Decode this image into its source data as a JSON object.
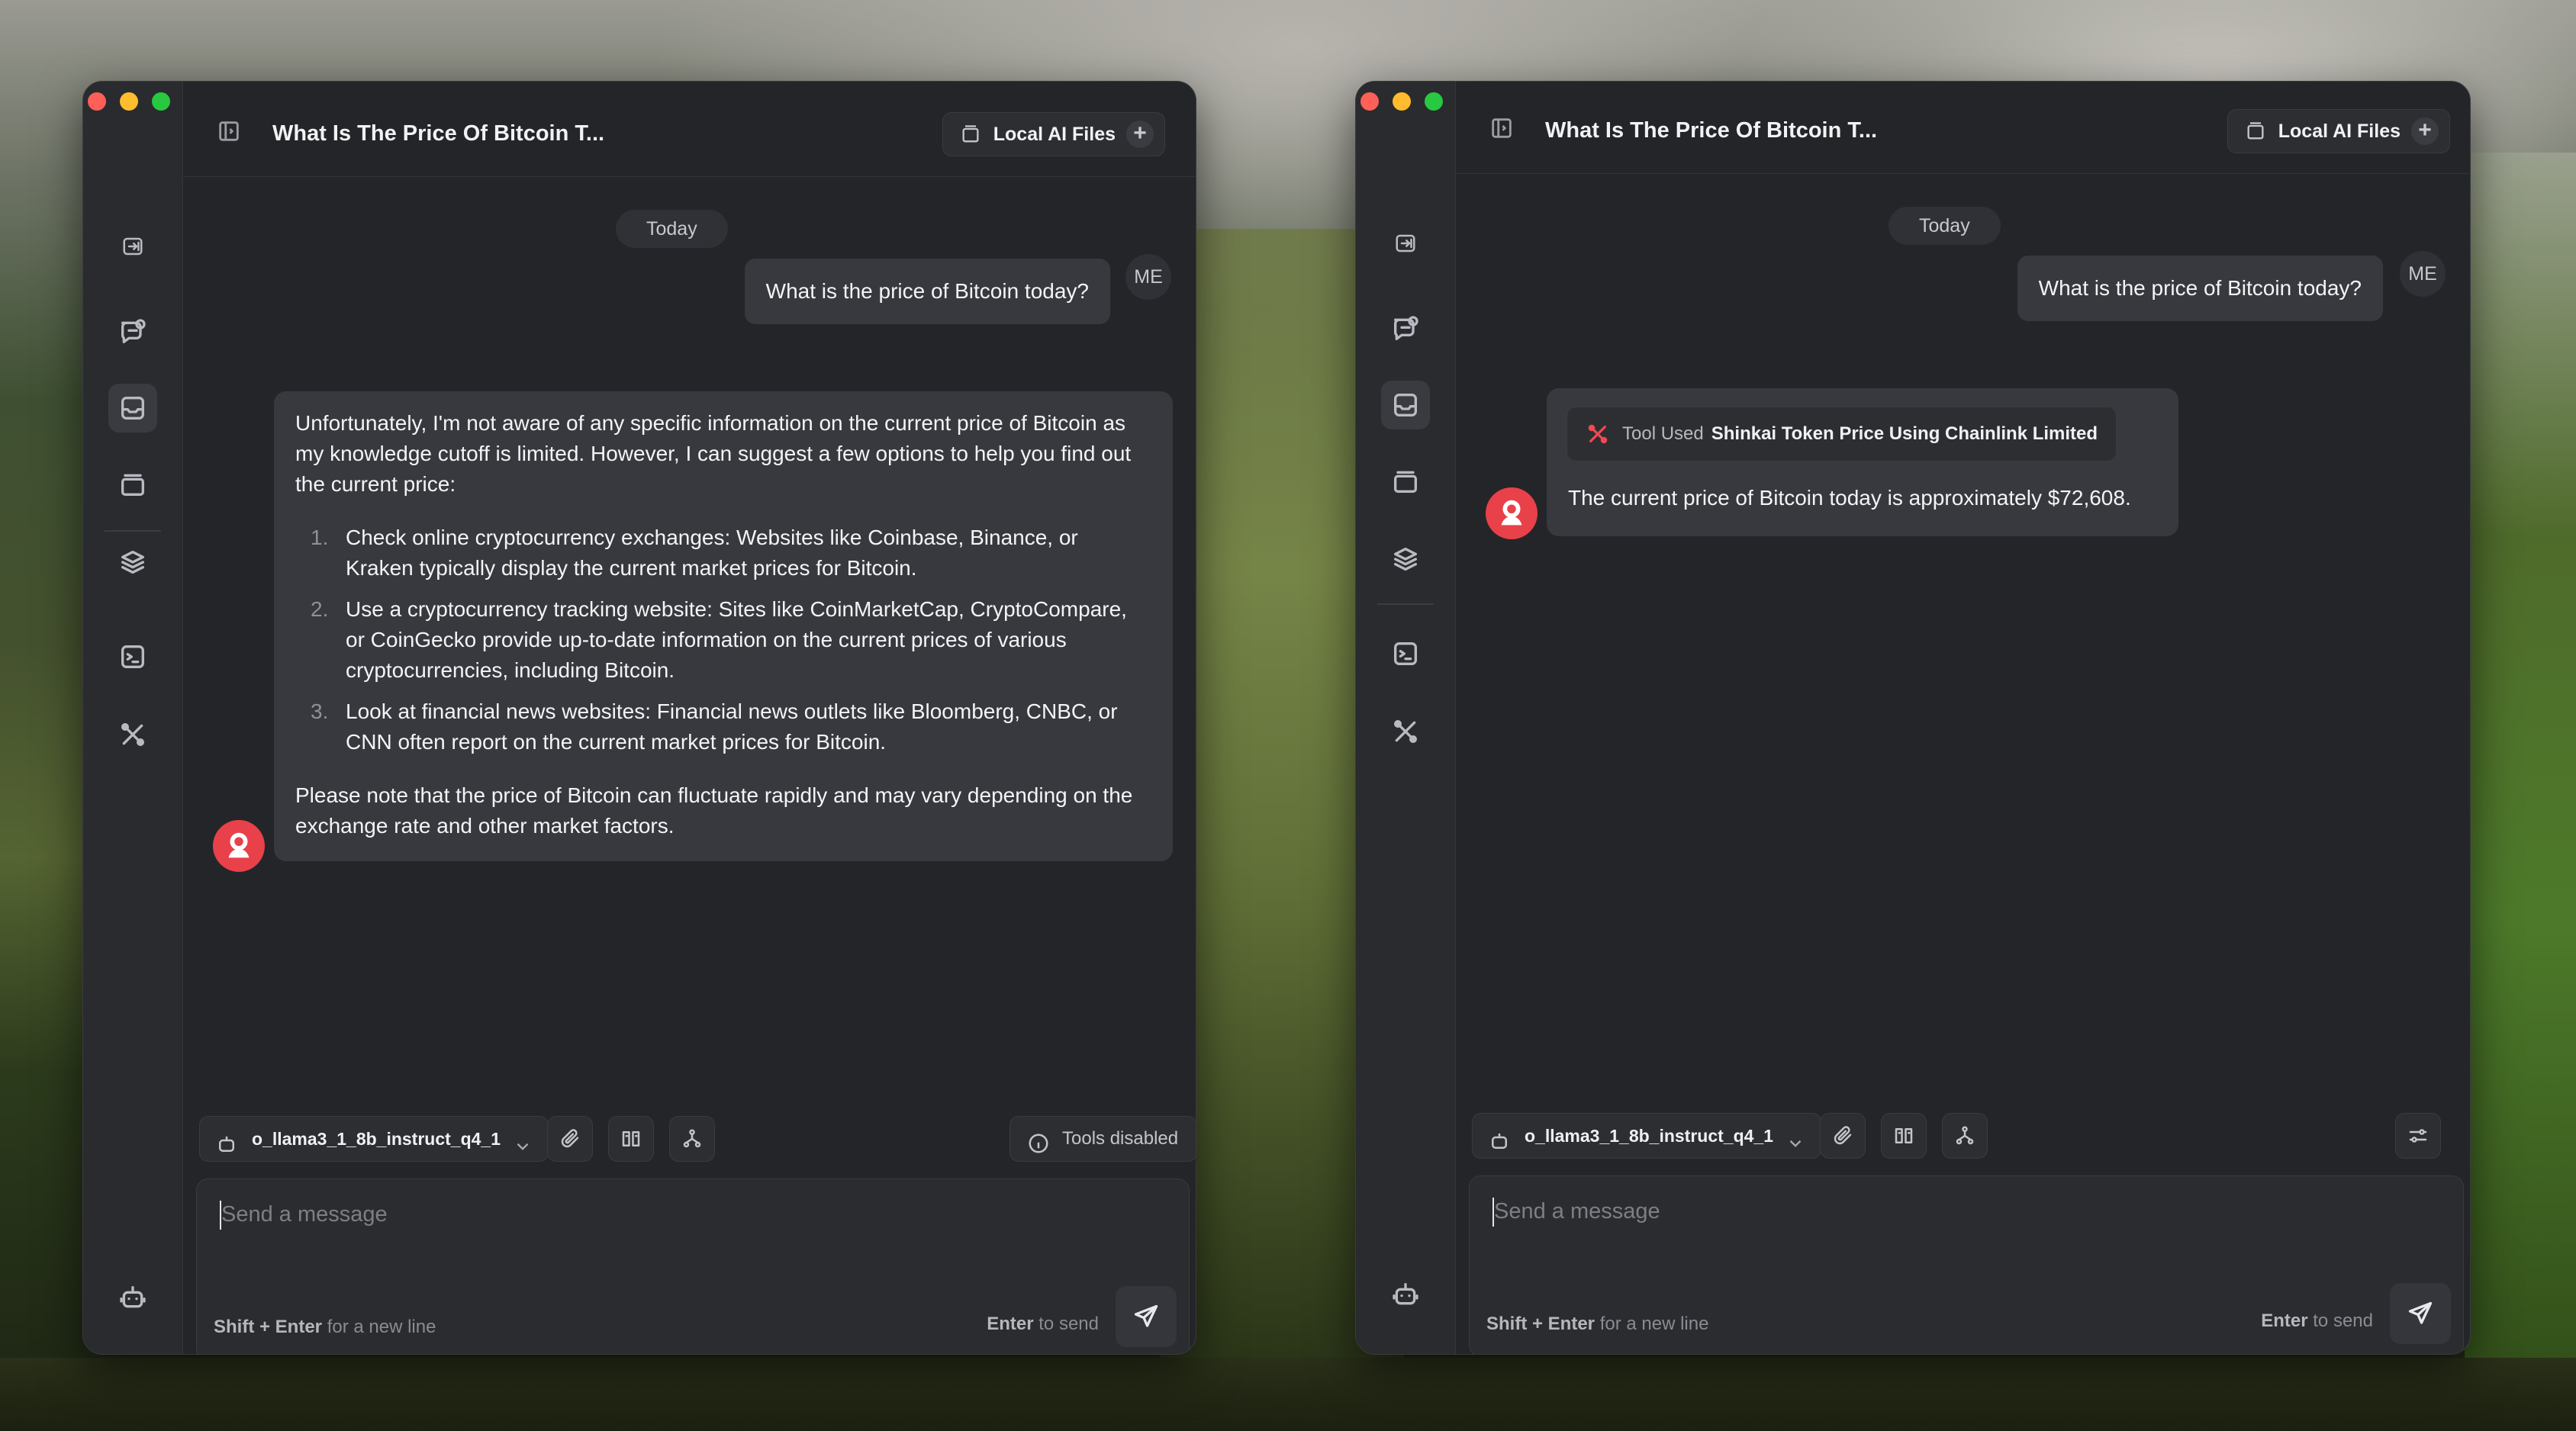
{
  "left_window": {
    "title": "What Is The Price Of Bitcoin T...",
    "files_label": "Local AI Files",
    "add_label": "+",
    "date_divider": "Today",
    "user_message": "What is the price of Bitcoin today?",
    "user_avatar": "ME",
    "assistant": {
      "intro": "Unfortunately, I'm not aware of any specific information on the current price of Bitcoin as my knowledge cutoff is limited. However, I can suggest a few options to help you find out the current price:",
      "items": [
        {
          "num": "1.",
          "text": "Check online cryptocurrency exchanges: Websites like Coinbase, Binance, or Kraken typically display the current market prices for Bitcoin."
        },
        {
          "num": "2.",
          "text": "Use a cryptocurrency tracking website: Sites like CoinMarketCap, CryptoCompare, or CoinGecko provide up-to-date information on the current prices of various cryptocurrencies, including Bitcoin."
        },
        {
          "num": "3.",
          "text": "Look at financial news websites: Financial news outlets like Bloomberg, CNBC, or CNN often report on the current market prices for Bitcoin."
        }
      ],
      "outro": "Please note that the price of Bitcoin can fluctuate rapidly and may vary depending on the exchange rate and other market factors."
    },
    "model": "o_llama3_1_8b_instruct_q4_1",
    "tools_status": "Tools disabled",
    "input_placeholder": "Send a message",
    "hint_left_key": "Shift + Enter",
    "hint_left_text": "for a new line",
    "hint_right_key": "Enter",
    "hint_right_text": "to send"
  },
  "right_window": {
    "title": "What Is The Price Of Bitcoin T...",
    "files_label": "Local AI Files",
    "add_label": "+",
    "date_divider": "Today",
    "user_message": "What is the price of Bitcoin today?",
    "user_avatar": "ME",
    "tool_used_label": "Tool Used",
    "tool_used_name": "Shinkai Token Price Using Chainlink Limited",
    "assistant_message": "The current price of Bitcoin today is approximately $72,608.",
    "model": "o_llama3_1_8b_instruct_q4_1",
    "input_placeholder": "Send a message",
    "hint_left_key": "Shift + Enter",
    "hint_left_text": "for a new line",
    "hint_right_key": "Enter",
    "hint_right_text": "to send"
  },
  "icons": [
    "sidebar-collapse-icon",
    "new-chat-icon",
    "inbox-icon",
    "cards-icon",
    "layers-icon",
    "terminal-icon",
    "tools-icon",
    "robot-icon",
    "gear-icon",
    "panel-icon",
    "folder-icon",
    "plus-icon",
    "paperclip-icon",
    "book-icon",
    "workflow-icon",
    "info-icon",
    "sliders-icon",
    "send-icon",
    "chevron-down-icon",
    "shinkai-avatar-icon"
  ],
  "colors": {
    "accent": "#e8414a",
    "window_bg": "#242528",
    "bubble_bg": "#38393e"
  }
}
